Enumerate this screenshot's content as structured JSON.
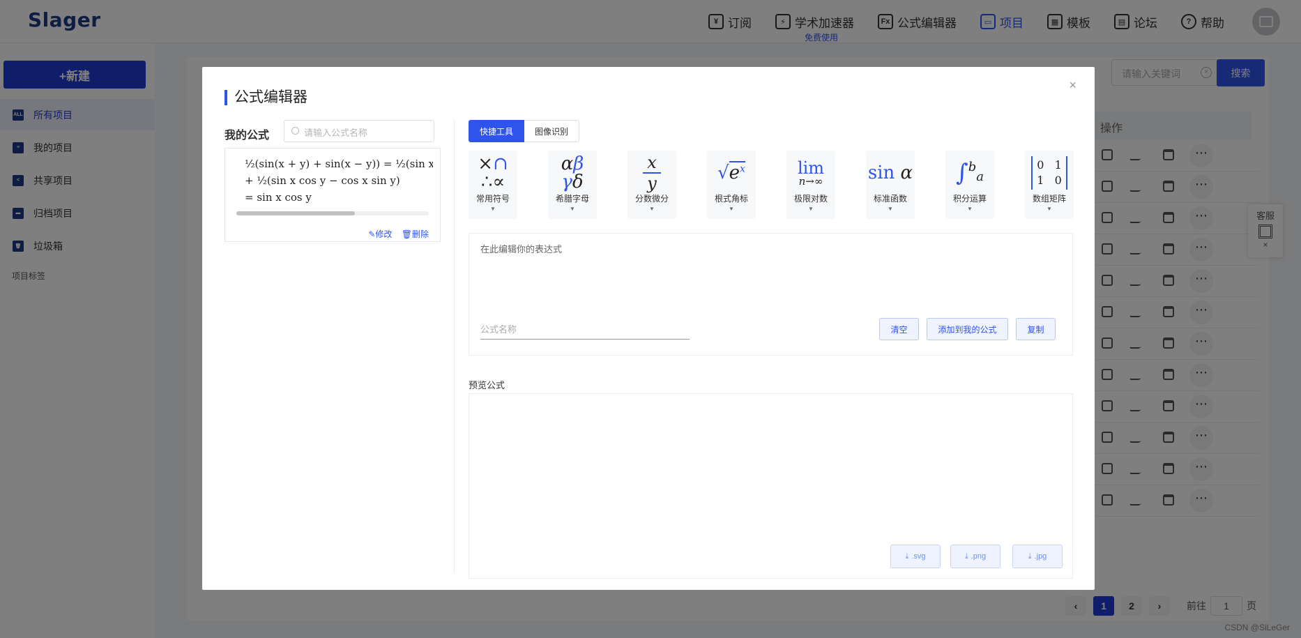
{
  "header": {
    "logo": "Slager",
    "nav": [
      {
        "label": "订阅",
        "icon": "subscribe-icon",
        "glyph": "¥"
      },
      {
        "label": "学术加速器",
        "icon": "accelerator-icon",
        "glyph": "⚡",
        "sub": "免费使用"
      },
      {
        "label": "公式编辑器",
        "icon": "formula-icon",
        "glyph": "Fx"
      },
      {
        "label": "项目",
        "icon": "project-icon",
        "glyph": "▭"
      },
      {
        "label": "模板",
        "icon": "template-icon",
        "glyph": "▦"
      },
      {
        "label": "论坛",
        "icon": "forum-icon",
        "glyph": "▤"
      },
      {
        "label": "帮助",
        "icon": "help-icon",
        "glyph": "?"
      }
    ],
    "accent": "#2f54eb"
  },
  "sidebar": {
    "new_label": "+新建",
    "items": [
      {
        "label": "所有项目",
        "glyph": "ALL"
      },
      {
        "label": "我的项目",
        "glyph": "≡"
      },
      {
        "label": "共享项目",
        "glyph": "<"
      },
      {
        "label": "归档项目",
        "glyph": "▬"
      },
      {
        "label": "垃圾箱",
        "glyph": "🗑"
      }
    ],
    "tags_label": "项目标签"
  },
  "background": {
    "search_placeholder": "请输入关键词",
    "search_button": "搜索",
    "table_header": "操作",
    "service_label": "客服",
    "service_close": "×",
    "pagination": {
      "prev": "‹",
      "next": "›",
      "pages": [
        "1",
        "2"
      ],
      "current": "1",
      "goto": "前往",
      "goto_value": "1",
      "page_unit": "页"
    },
    "watermark": "CSDN @SiLeGer"
  },
  "dialog": {
    "title": "公式编辑器",
    "close": "×",
    "my_formulas_label": "我的公式",
    "search_placeholder": "请输入公式名称",
    "formula_lines": [
      "½(sin(x + y) + sin(x − y)) = ½(sin x cos y",
      "+ ½(sin x cos y − cos x sin y)",
      "= sin x cos y"
    ],
    "edit_label": "✎修改",
    "delete_label": "🗑删除",
    "tabs": [
      "快捷工具",
      "图像识别"
    ],
    "tools": [
      {
        "label": "常用符号",
        "caret": "▼"
      },
      {
        "label": "希腊字母",
        "caret": "▼"
      },
      {
        "label": "分数微分",
        "caret": "▼"
      },
      {
        "label": "根式角标",
        "caret": "▼"
      },
      {
        "label": "极限对数",
        "caret": "▼"
      },
      {
        "label": "标准函数",
        "caret": "▼"
      },
      {
        "label": "积分运算",
        "caret": "▼"
      },
      {
        "label": "数组矩阵",
        "caret": "▼"
      }
    ],
    "editor_placeholder": "在此编辑你的表达式",
    "name_placeholder": "公式名称",
    "clear_button": "清空",
    "add_button": "添加到我的公式",
    "copy_button": "复制",
    "preview_label": "预览公式",
    "download": {
      "svg": ".svg",
      "png": ".png",
      "jpg": ".jpg",
      "glyph": "⤓"
    }
  }
}
